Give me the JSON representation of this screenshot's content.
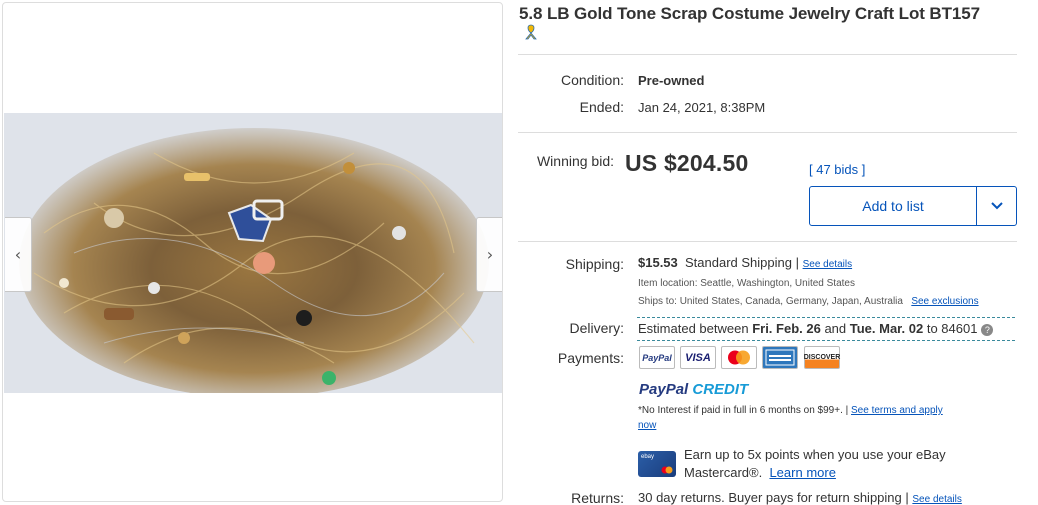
{
  "listing": {
    "title": "5.8 LB Gold Tone Scrap Costume Jewelry Craft Lot BT157"
  },
  "gallery": {
    "prev_glyph": "‹",
    "next_glyph": "›"
  },
  "details": {
    "condition_label": "Condition:",
    "condition_value": "Pre-owned",
    "ended_label": "Ended:",
    "ended_value": "Jan 24, 2021, 8:38PM"
  },
  "bid": {
    "label": "Winning bid:",
    "price": "US $204.50",
    "bids_link": "[ 47 bids ]",
    "add_to_list": "Add to list"
  },
  "shipping": {
    "label": "Shipping:",
    "cost": "$15.53",
    "method": "Standard Shipping |",
    "details_link": "See details",
    "item_location": "Item location:  Seattle, Washington, United States",
    "ships_to": "Ships to:  United States, Canada, Germany, Japan, Australia",
    "exclusions_link": "See exclusions"
  },
  "delivery": {
    "label": "Delivery:",
    "prefix": "Estimated between ",
    "date_from": "Fri. Feb. 26",
    "and": " and ",
    "date_to": "Tue. Mar. 02",
    "suffix": " to 84601"
  },
  "payments": {
    "label": "Payments:",
    "methods": [
      "PayPal",
      "VISA",
      "Mastercard",
      "American Express",
      "DISCOVER"
    ],
    "paypal_credit_a": "PayPal",
    "paypal_credit_b": "CREDIT",
    "credit_terms": "*No Interest if paid in full in 6 months on $99+.  |",
    "terms_link_a": "See terms and apply",
    "terms_link_b": "now",
    "card_promo_a": "Earn up to 5x points when you use your eBay",
    "card_promo_b": "Mastercard®.",
    "learn_more": "Learn more"
  },
  "returns": {
    "label": "Returns:",
    "value": "30 day returns. Buyer pays for return shipping |",
    "details_link": "See details"
  },
  "colors": {
    "link": "#0654ba",
    "text": "#333333",
    "dashed_border": "#3a8a9c"
  }
}
